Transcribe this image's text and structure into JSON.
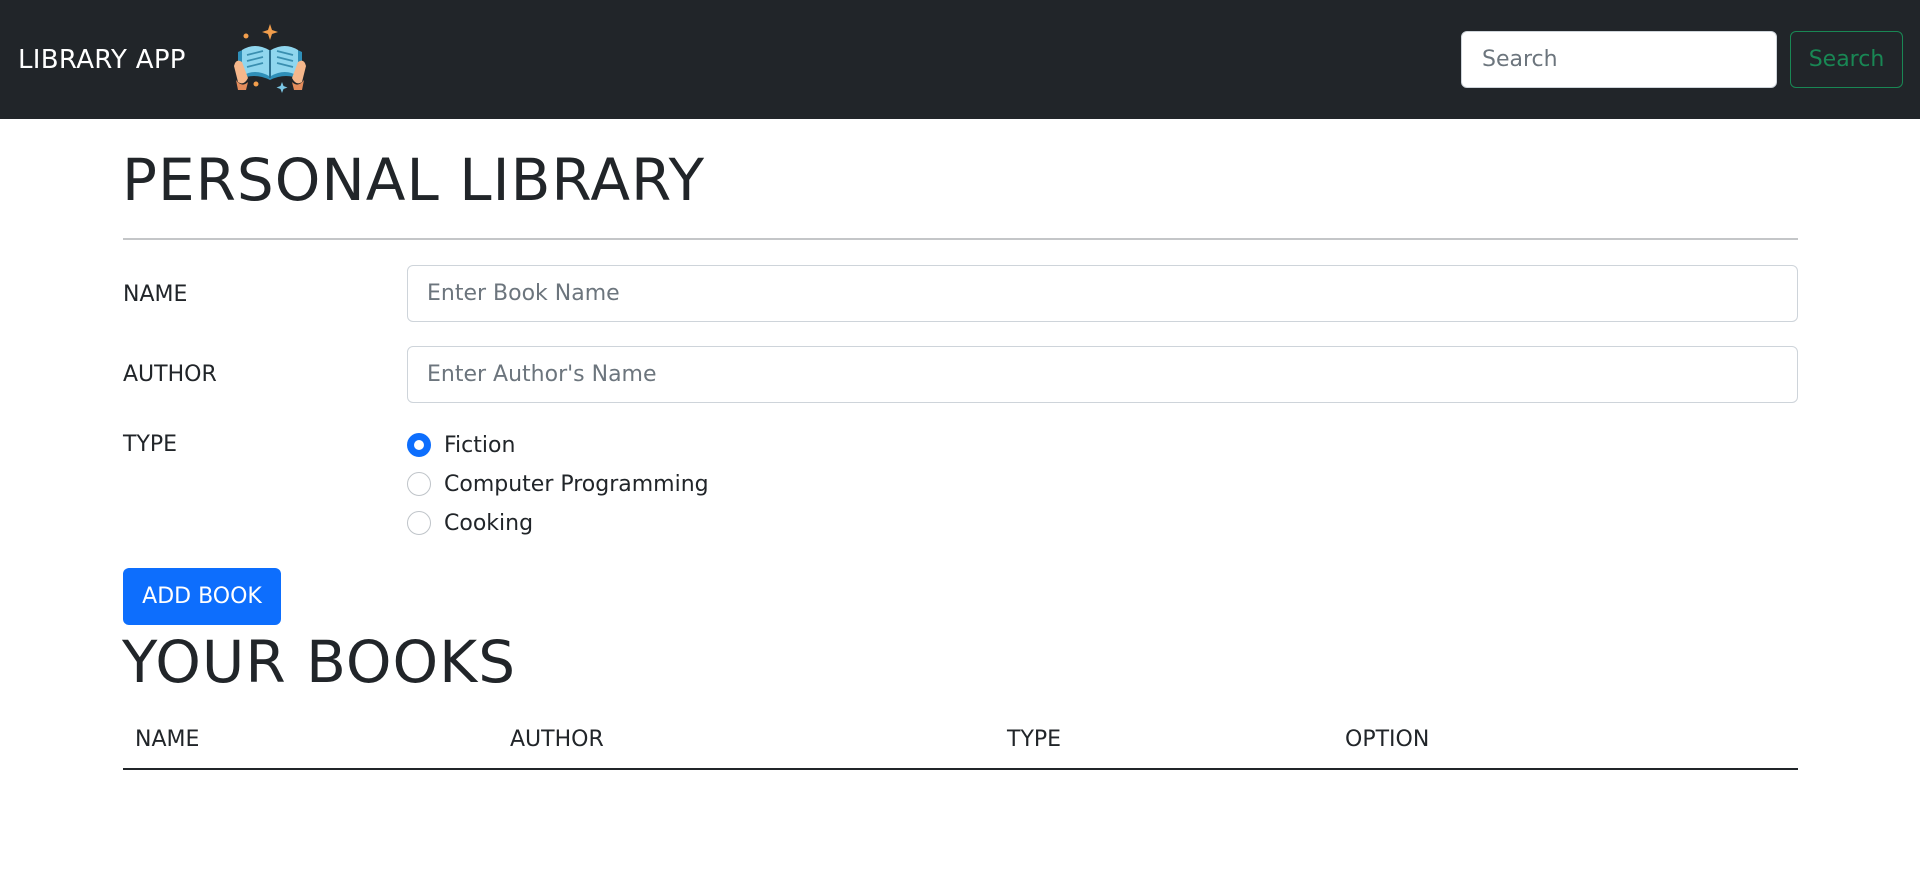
{
  "navbar": {
    "brand": "LIBRARY APP",
    "logo_icon": "book-reading-hands-icon",
    "search_placeholder": "Search",
    "search_button": "Search"
  },
  "form": {
    "title": "PERSONAL LIBRARY",
    "name_label": "NAME",
    "name_placeholder": "Enter Book Name",
    "author_label": "AUTHOR",
    "author_placeholder": "Enter Author's Name",
    "type_label": "TYPE",
    "types": [
      {
        "label": "Fiction",
        "checked": true
      },
      {
        "label": "Computer Programming",
        "checked": false
      },
      {
        "label": "Cooking",
        "checked": false
      }
    ],
    "add_button": "ADD BOOK"
  },
  "books": {
    "title": "YOUR BOOKS",
    "columns": [
      "NAME",
      "AUTHOR",
      "TYPE",
      "OPTION"
    ],
    "rows": []
  },
  "colors": {
    "navbar_bg": "#212529",
    "primary": "#0d6efd",
    "success": "#198754"
  }
}
